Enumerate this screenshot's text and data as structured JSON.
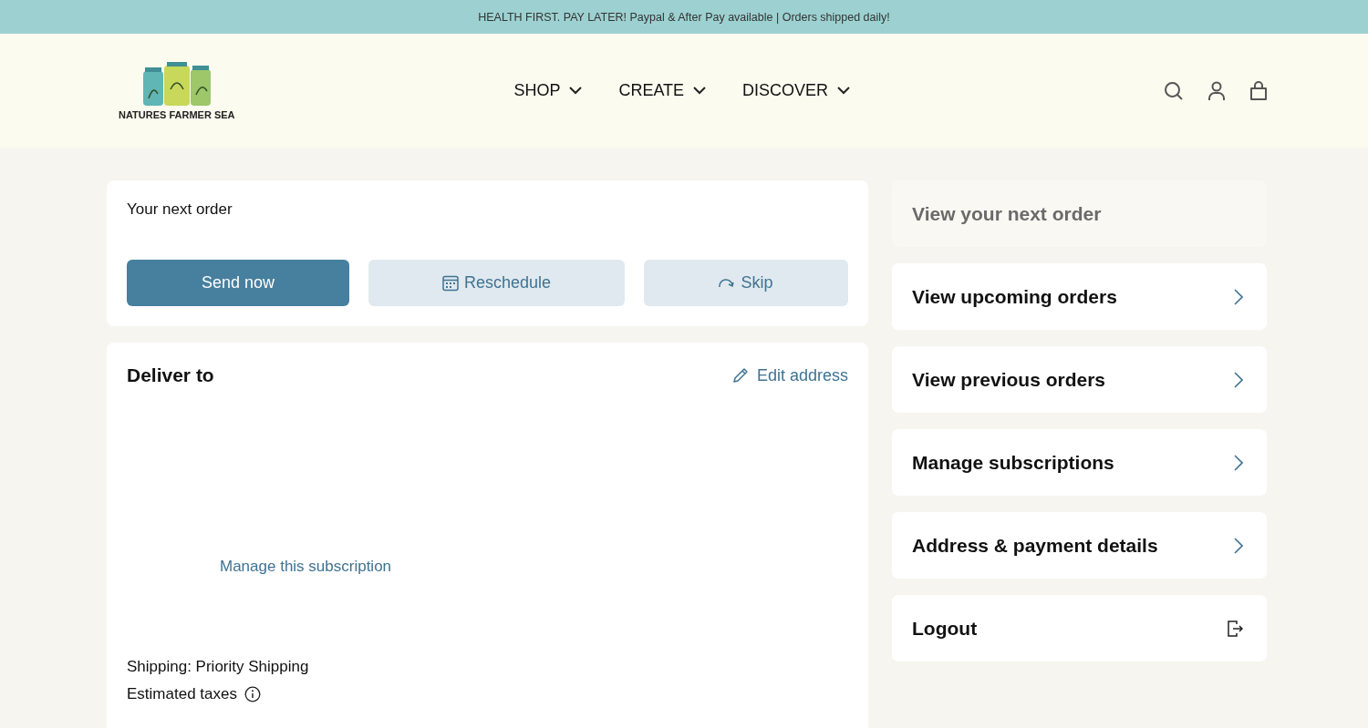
{
  "announcement": "HEALTH FIRST. PAY LATER! Paypal & After Pay available | Orders shipped daily!",
  "logo": {
    "text": "NATURES FARMER SEA"
  },
  "nav": [
    {
      "label": "SHOP"
    },
    {
      "label": "CREATE"
    },
    {
      "label": "DISCOVER"
    }
  ],
  "next_order": {
    "title": "Your next order",
    "buttons": [
      {
        "label": "Send now",
        "kind": "primary"
      },
      {
        "label": "Reschedule",
        "kind": "calendar"
      },
      {
        "label": "Skip",
        "kind": "skip"
      }
    ]
  },
  "delivery": {
    "title": "Deliver to",
    "edit_link": "Edit address",
    "manage_link": "Manage this subscription",
    "shipping": "Shipping: Priority Shipping",
    "taxes": "Estimated taxes"
  },
  "menu": [
    {
      "label": "View your next order",
      "selected": true
    },
    {
      "label": "View upcoming orders",
      "selected": false,
      "kind": "chevron"
    },
    {
      "label": "View previous orders",
      "selected": false,
      "kind": "chevron"
    },
    {
      "label": "Manage subscriptions",
      "selected": false,
      "kind": "chevron"
    },
    {
      "label": "Address & payment details",
      "selected": false,
      "kind": "chevron"
    },
    {
      "label": "Logout",
      "selected": false,
      "kind": "logout"
    }
  ]
}
